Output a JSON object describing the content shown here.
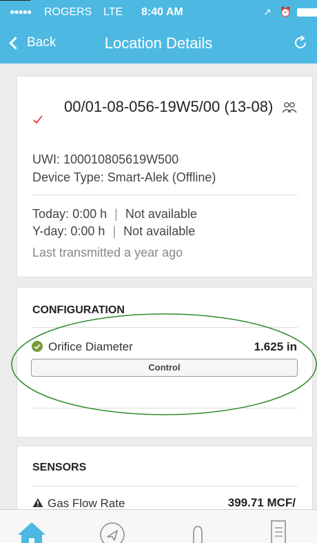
{
  "status_bar": {
    "signal": "●●●●●",
    "carrier": "ROGERS",
    "network": "LTE",
    "time": "8:40 AM",
    "right_icons": "↗ ⏰ ✱"
  },
  "nav": {
    "back_label": "Back",
    "title": "Location Details",
    "refresh_icon": "refresh-icon"
  },
  "location": {
    "name": "00/01-08-056-19W5/00 (13-08)",
    "uwi": "UWI: 100010805619W500",
    "device_type": "Device Type: Smart-Alek (Offline)",
    "today_label": "Today:",
    "today_hours": "0:00 h",
    "today_status": "Not available",
    "yday_label": "Y-day:",
    "yday_hours": "0:00 h",
    "yday_status": "Not available",
    "separator": "|",
    "last_transmitted": "Last transmitted a year ago"
  },
  "configuration": {
    "title": "CONFIGURATION",
    "items": [
      {
        "label": "Orifice Diameter",
        "value": "1.625 in",
        "status_icon": "check-circle-icon"
      }
    ],
    "control_label": "Control"
  },
  "sensors": {
    "title": "SENSORS",
    "items": [
      {
        "label": "Gas Flow Rate",
        "value": "399.71 MCF/",
        "status_icon": "warning-icon"
      }
    ]
  },
  "tabs": [
    {
      "name": "home",
      "icon": "home-icon",
      "active": true
    },
    {
      "name": "navigate",
      "icon": "navigation-icon",
      "active": false
    },
    {
      "name": "route",
      "icon": "route-icon",
      "active": false
    },
    {
      "name": "list",
      "icon": "list-icon",
      "active": false
    }
  ],
  "colors": {
    "accent": "#4db8e2",
    "check_red": "#e0393e",
    "ok_green": "#7a9a3a",
    "highlight_green": "#2e8b2e"
  }
}
